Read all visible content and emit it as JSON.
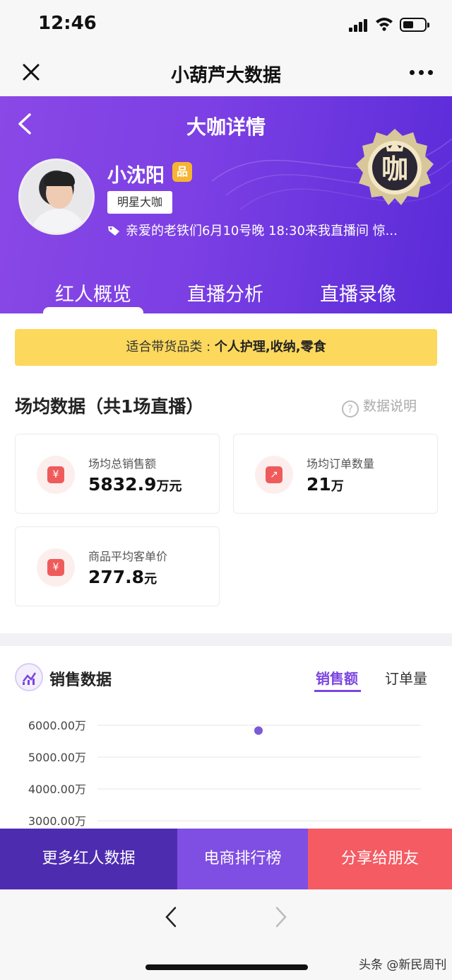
{
  "status_bar": {
    "time": "12:46"
  },
  "wechat_bar": {
    "title": "小葫芦大数据"
  },
  "header": {
    "title": "大咖详情",
    "name": "小沈阳",
    "name_badge": "品",
    "tag": "明星大咖",
    "bio": "亲爱的老铁们6月10号晚 18:30来我直播间 惊...",
    "medal_char": "咖",
    "tabs": [
      {
        "label": "红人概览",
        "active": true
      },
      {
        "label": "直播分析",
        "active": false
      },
      {
        "label": "直播录像",
        "active": false
      }
    ]
  },
  "banner": {
    "prefix": "适合带货品类 : ",
    "categories": "个人护理,收纳,零食"
  },
  "section": {
    "title": "场均数据（共1场直播）",
    "help": "数据说明"
  },
  "cards": [
    {
      "label": "场均总销售额",
      "value": "5832.9",
      "unit": "万元",
      "icon": "money-bag-icon"
    },
    {
      "label": "场均订单数量",
      "value": "21",
      "unit": "万",
      "icon": "order-chart-icon"
    },
    {
      "label": "商品平均客单价",
      "value": "277.8",
      "unit": "元",
      "icon": "yuan-ticket-icon"
    }
  ],
  "sales": {
    "title": "销售数据",
    "tabs": [
      {
        "label": "销售额",
        "active": true
      },
      {
        "label": "订单量",
        "active": false
      }
    ]
  },
  "chart_data": {
    "type": "scatter",
    "y_tick_labels": [
      "6000.00万",
      "5000.00万",
      "4000.00万",
      "3000.00万"
    ],
    "y_ticks": [
      6000,
      5000,
      4000,
      3000
    ],
    "points": [
      {
        "y": 5832.9
      }
    ],
    "color": "#7b5ad6"
  },
  "actions": [
    {
      "label": "更多红人数据",
      "color": "#4e2cb0"
    },
    {
      "label": "电商排行榜",
      "color": "#7f4ee2"
    },
    {
      "label": "分享给朋友",
      "color": "#f45b63"
    }
  ],
  "watermark": "头条 @新民周刊"
}
